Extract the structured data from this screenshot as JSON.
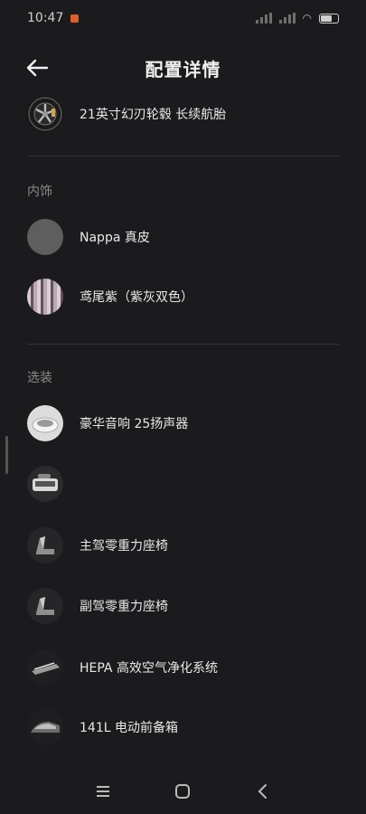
{
  "status_bar": {
    "time": "10:47",
    "battery": "63"
  },
  "header": {
    "title": "配置详情"
  },
  "rows_top": [
    {
      "label": "21英寸幻刃轮毂 长续航胎",
      "icon": "wheel-icon"
    }
  ],
  "interior": {
    "title": "内饰",
    "items": [
      {
        "label": "Nappa 真皮",
        "icon": "leather-swatch-icon",
        "color": "#5e5e5e"
      },
      {
        "label": "鸢尾紫（紫灰双色）",
        "icon": "stripe-swatch-icon",
        "color": "#8a6f80"
      }
    ]
  },
  "options": {
    "title": "选装",
    "items": [
      {
        "label": "豪华音响 25扬声器",
        "icon": "speaker-icon"
      },
      {
        "label": "",
        "icon": "console-icon"
      },
      {
        "label": "主驾零重力座椅",
        "icon": "seat-icon"
      },
      {
        "label": "副驾零重力座椅",
        "icon": "seat-icon"
      },
      {
        "label": "HEPA 高效空气净化系统",
        "icon": "air-filter-icon"
      },
      {
        "label": "141L 电动前备箱",
        "icon": "frunk-icon"
      }
    ]
  },
  "nav": {
    "items": [
      "menu-icon",
      "home-icon",
      "back-icon"
    ]
  }
}
